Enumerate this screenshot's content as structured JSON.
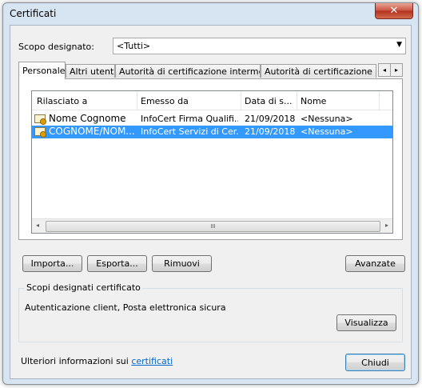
{
  "window": {
    "title": "Certificati",
    "close_glyph": "✕"
  },
  "purpose": {
    "label": "Scopo designato:",
    "selected": "<Tutti>"
  },
  "tabs": [
    {
      "label": "Personale"
    },
    {
      "label": "Altri utenti"
    },
    {
      "label": "Autorità di certificazione intermedie"
    },
    {
      "label": "Autorità di certificazione radi"
    }
  ],
  "tab_scroll": {
    "left": "◂",
    "right": "▸"
  },
  "list": {
    "columns": [
      "Rilasciato a",
      "Emesso da",
      "Data di s...",
      "Nome"
    ],
    "rows": [
      {
        "issued_to": "Nome Cognome",
        "issued_by": "InfoCert Firma Qualifi...",
        "date": "21/09/2018",
        "name": "<Nessuna>",
        "selected": false
      },
      {
        "issued_to": "COGNOME/NOM...",
        "issued_by": "InfoCert Servizi di Cer...",
        "date": "21/09/2018",
        "name": "<Nessuna>",
        "selected": true
      }
    ],
    "scroll": {
      "left": "◂",
      "right": "▸",
      "grip": "III"
    }
  },
  "buttons": {
    "import": "Importa...",
    "export": "Esporta...",
    "remove": "Rimuovi",
    "advanced": "Avanzate",
    "view": "Visualizza",
    "close": "Chiudi"
  },
  "purposes_group": {
    "title": "Scopi designati certificato",
    "text": "Autenticazione client, Posta elettronica sicura"
  },
  "footer": {
    "text": "Ulteriori informazioni sui ",
    "link": "certificati"
  },
  "icons": {
    "certificate": "certificate-icon",
    "dropdown": "chevron-down-icon"
  },
  "colors": {
    "selection": "#3399ff",
    "link": "#0066cc",
    "frame": "#d7e4f2"
  }
}
